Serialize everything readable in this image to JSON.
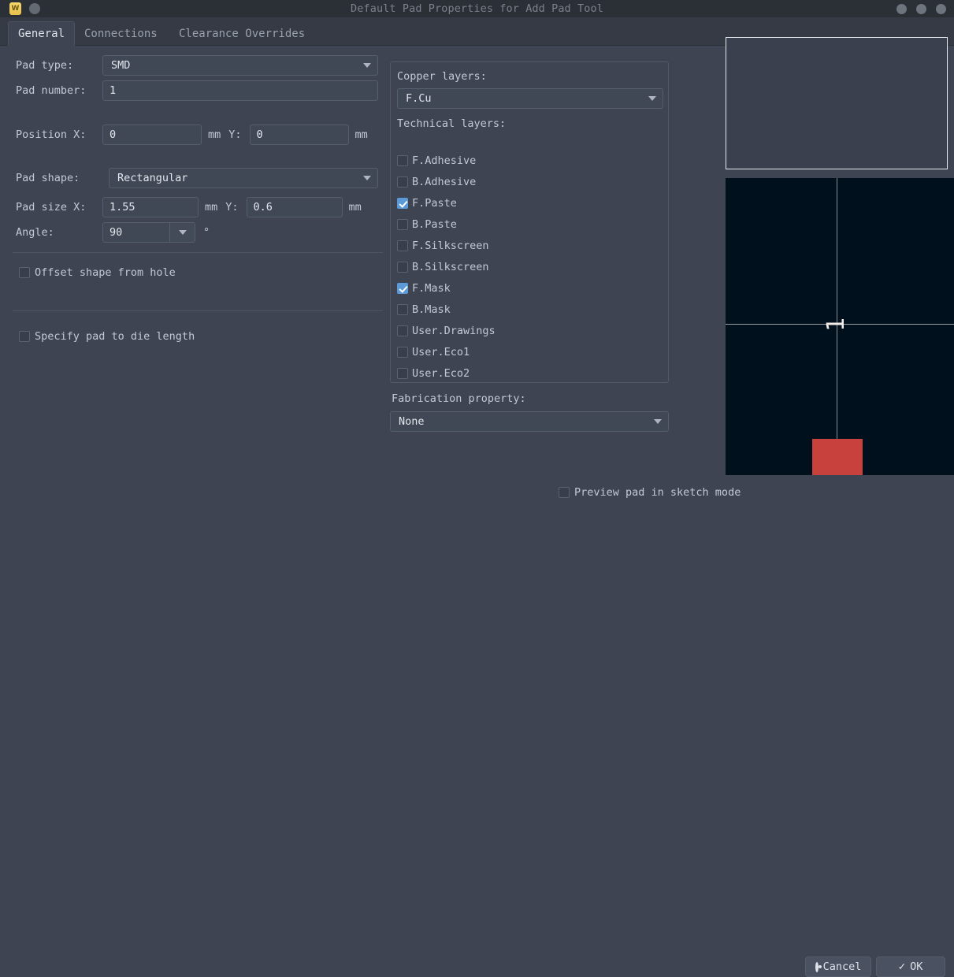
{
  "window": {
    "title": "Default Pad Properties for Add Pad Tool",
    "app_icon_letter": "W",
    "icon_names": [
      "app-icon",
      "menu-dot-icon",
      "minimize-button",
      "maximize-button",
      "close-button"
    ]
  },
  "tabs": [
    {
      "label": "General",
      "active": true
    },
    {
      "label": "Connections",
      "active": false
    },
    {
      "label": "Clearance Overrides",
      "active": false
    }
  ],
  "general": {
    "pad_type_label": "Pad type:",
    "pad_type_value": "SMD",
    "pad_number_label": "Pad number:",
    "pad_number_value": "1",
    "position_x_label": "Position X:",
    "position_x_value": "0",
    "position_x_unit": "mm",
    "position_y_label": "Y:",
    "position_y_value": "0",
    "position_y_unit": "mm",
    "pad_shape_label": "Pad shape:",
    "pad_shape_value": "Rectangular",
    "pad_size_x_label": "Pad size X:",
    "pad_size_x_value": "1.55",
    "pad_size_x_unit": "mm",
    "pad_size_y_label": "Y:",
    "pad_size_y_value": "0.6",
    "pad_size_y_unit": "mm",
    "angle_label": "Angle:",
    "angle_value": "90",
    "angle_unit": "°",
    "offset_shape_label": "Offset shape from hole",
    "offset_shape_checked": false,
    "die_length_label": "Specify pad to die length",
    "die_length_checked": false
  },
  "layers": {
    "copper_label": "Copper layers:",
    "copper_value": "F.Cu",
    "technical_label": "Technical layers:",
    "items": [
      {
        "label": "F.Adhesive",
        "checked": false
      },
      {
        "label": "B.Adhesive",
        "checked": false
      },
      {
        "label": "F.Paste",
        "checked": true
      },
      {
        "label": "B.Paste",
        "checked": false
      },
      {
        "label": "F.Silkscreen",
        "checked": false
      },
      {
        "label": "B.Silkscreen",
        "checked": false
      },
      {
        "label": "F.Mask",
        "checked": true
      },
      {
        "label": "B.Mask",
        "checked": false
      },
      {
        "label": "User.Drawings",
        "checked": false
      },
      {
        "label": "User.Eco1",
        "checked": false
      },
      {
        "label": "User.Eco2",
        "checked": false
      }
    ]
  },
  "fabrication": {
    "label": "Fabrication property:",
    "value": "None"
  },
  "preview": {
    "pad_label": "1",
    "pad_color": "#c8413c",
    "canvas_color": "#00101d",
    "crosshair_color": "#9aa0a6"
  },
  "footer": {
    "sketch_mode_label": "Preview pad in sketch mode",
    "sketch_mode_checked": false,
    "cancel_label": "Cancel",
    "ok_label": "OK"
  },
  "colors": {
    "dialog_bg": "#3e4451",
    "titlebar_bg": "#2b2f36",
    "accent_checked": "#5b9ad6",
    "text_primary": "#c3c9d4"
  }
}
